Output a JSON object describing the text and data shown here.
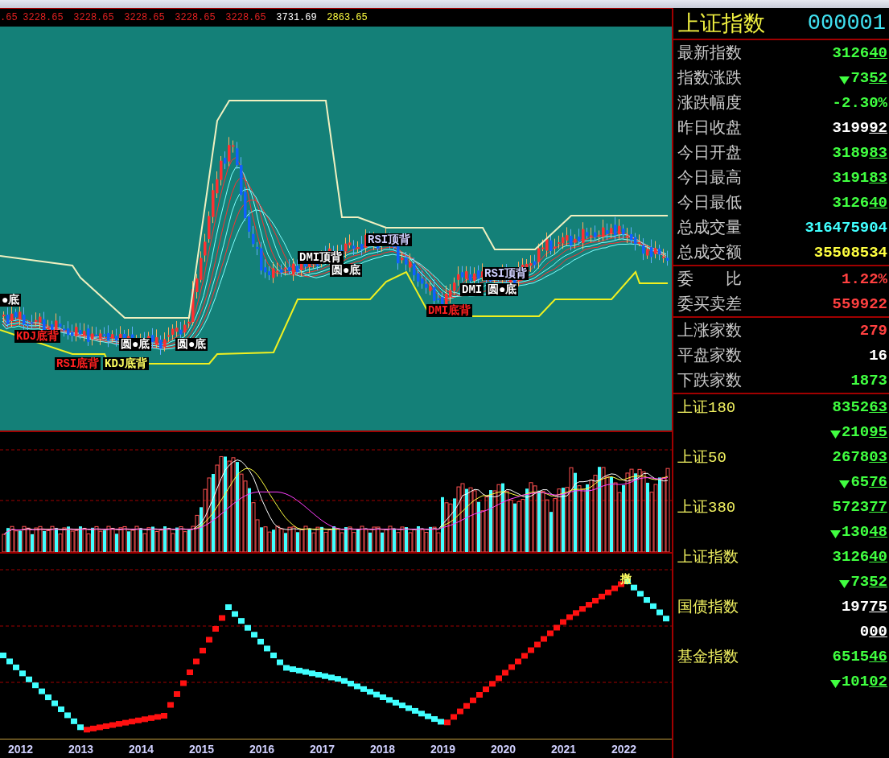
{
  "price_bar": {
    "items": [
      {
        "text": ".65",
        "color": "#e02020"
      },
      {
        "text": "3228.65",
        "color": "#e02020"
      },
      {
        "text": "3228.65",
        "color": "#e02020"
      },
      {
        "text": "3228.65",
        "color": "#e02020"
      },
      {
        "text": "3228.65",
        "color": "#e02020"
      },
      {
        "text": "3228.65",
        "color": "#e02020"
      },
      {
        "text": "3731.69",
        "color": "#ffffff"
      },
      {
        "text": "2863.65",
        "color": "#ffff40"
      }
    ]
  },
  "main_chart": {
    "annotations": [
      {
        "text": "●底",
        "kind": "plain"
      },
      {
        "text": "KDJ底背",
        "kind": "alert"
      },
      {
        "text": "RSI底背",
        "kind": "alert"
      },
      {
        "text": "KDJ底背",
        "kind": "highlight"
      },
      {
        "text": "圆●底",
        "kind": "plain"
      },
      {
        "text": "圆●底",
        "kind": "plain"
      },
      {
        "text": "DMI顶背",
        "kind": "plain"
      },
      {
        "text": "圆●底",
        "kind": "plain"
      },
      {
        "text": "RSI顶背",
        "kind": "muted"
      },
      {
        "text": "DMI底背",
        "kind": "alert"
      },
      {
        "text": "RSI顶背",
        "kind": "muted"
      },
      {
        "text": "DMI",
        "kind": "plain"
      },
      {
        "text": "圆●底",
        "kind": "plain"
      }
    ]
  },
  "indicator_chart": {
    "annotations": [
      {
        "text": "撤",
        "kind": "highlight"
      }
    ]
  },
  "x_axis": {
    "labels": [
      "2012",
      "2013",
      "2014",
      "2015",
      "2016",
      "2017",
      "2018",
      "2019",
      "2020",
      "2021",
      "2022"
    ]
  },
  "quote_panel": {
    "name": "上证指数",
    "code": "000001",
    "sections": [
      {
        "rows": [
          {
            "label": "最新指数",
            "value": "3126",
            "decimals": "40",
            "arrow": false,
            "color": "#40ff40"
          },
          {
            "label": "指数涨跌",
            "value": "73",
            "decimals": "52",
            "arrow": true,
            "color": "#40ff40"
          },
          {
            "label": "涨跌幅度",
            "value": "-2.30%",
            "arrow": false,
            "color": "#40ff40"
          },
          {
            "label": "昨日收盘",
            "value": "3199",
            "decimals": "92",
            "arrow": false,
            "color": "#ffffff"
          },
          {
            "label": "今日开盘",
            "value": "3189",
            "decimals": "83",
            "arrow": false,
            "color": "#40ff40"
          },
          {
            "label": "今日最高",
            "value": "3191",
            "decimals": "83",
            "arrow": false,
            "color": "#40ff40"
          },
          {
            "label": "今日最低",
            "value": "3126",
            "decimals": "40",
            "arrow": false,
            "color": "#40ff40"
          },
          {
            "label": "总成交量",
            "value": "316475904",
            "arrow": false,
            "color": "#40ffff"
          },
          {
            "label": "总成交额",
            "value": "35508534",
            "arrow": false,
            "color": "#ffff40"
          }
        ]
      },
      {
        "rows": [
          {
            "label": "委　　比",
            "value": "1.22%",
            "arrow": false,
            "color": "#ff4040"
          },
          {
            "label": "委买卖差",
            "value": "559922",
            "arrow": false,
            "color": "#ff4040"
          }
        ]
      },
      {
        "rows": [
          {
            "label": "上涨家数",
            "value": "279",
            "arrow": false,
            "color": "#ff4040"
          },
          {
            "label": "平盘家数",
            "value": "16",
            "arrow": false,
            "color": "#ffffff"
          },
          {
            "label": "下跌家数",
            "value": "1873",
            "arrow": false,
            "color": "#40ff40"
          }
        ]
      }
    ]
  },
  "index_list": [
    {
      "name": "上证180",
      "value": "8352",
      "decimals": "63",
      "arrow": false,
      "color": "#40ff40"
    },
    {
      "value": "210",
      "decimals": "95",
      "arrow": true,
      "color": "#40ff40"
    },
    {
      "name": "上证50",
      "value": "2678",
      "decimals": "03",
      "arrow": false,
      "color": "#40ff40"
    },
    {
      "value": "65",
      "decimals": "76",
      "arrow": true,
      "color": "#40ff40"
    },
    {
      "name": "上证380",
      "value": "5723",
      "decimals": "77",
      "arrow": false,
      "color": "#40ff40"
    },
    {
      "value": "130",
      "decimals": "48",
      "arrow": true,
      "color": "#40ff40"
    },
    {
      "name": "上证指数",
      "value": "3126",
      "decimals": "40",
      "arrow": false,
      "color": "#40ff40"
    },
    {
      "value": "73",
      "decimals": "52",
      "arrow": true,
      "color": "#40ff40"
    },
    {
      "name": "国债指数",
      "value": "197",
      "decimals": "75",
      "arrow": false,
      "color": "#ffffff"
    },
    {
      "value": "0",
      "decimals": "00",
      "arrow": false,
      "color": "#ffffff"
    },
    {
      "name": "基金指数",
      "value": "6515",
      "decimals": "46",
      "arrow": false,
      "color": "#40ff40"
    },
    {
      "value": "101",
      "decimals": "02",
      "arrow": true,
      "color": "#40ff40"
    }
  ]
}
